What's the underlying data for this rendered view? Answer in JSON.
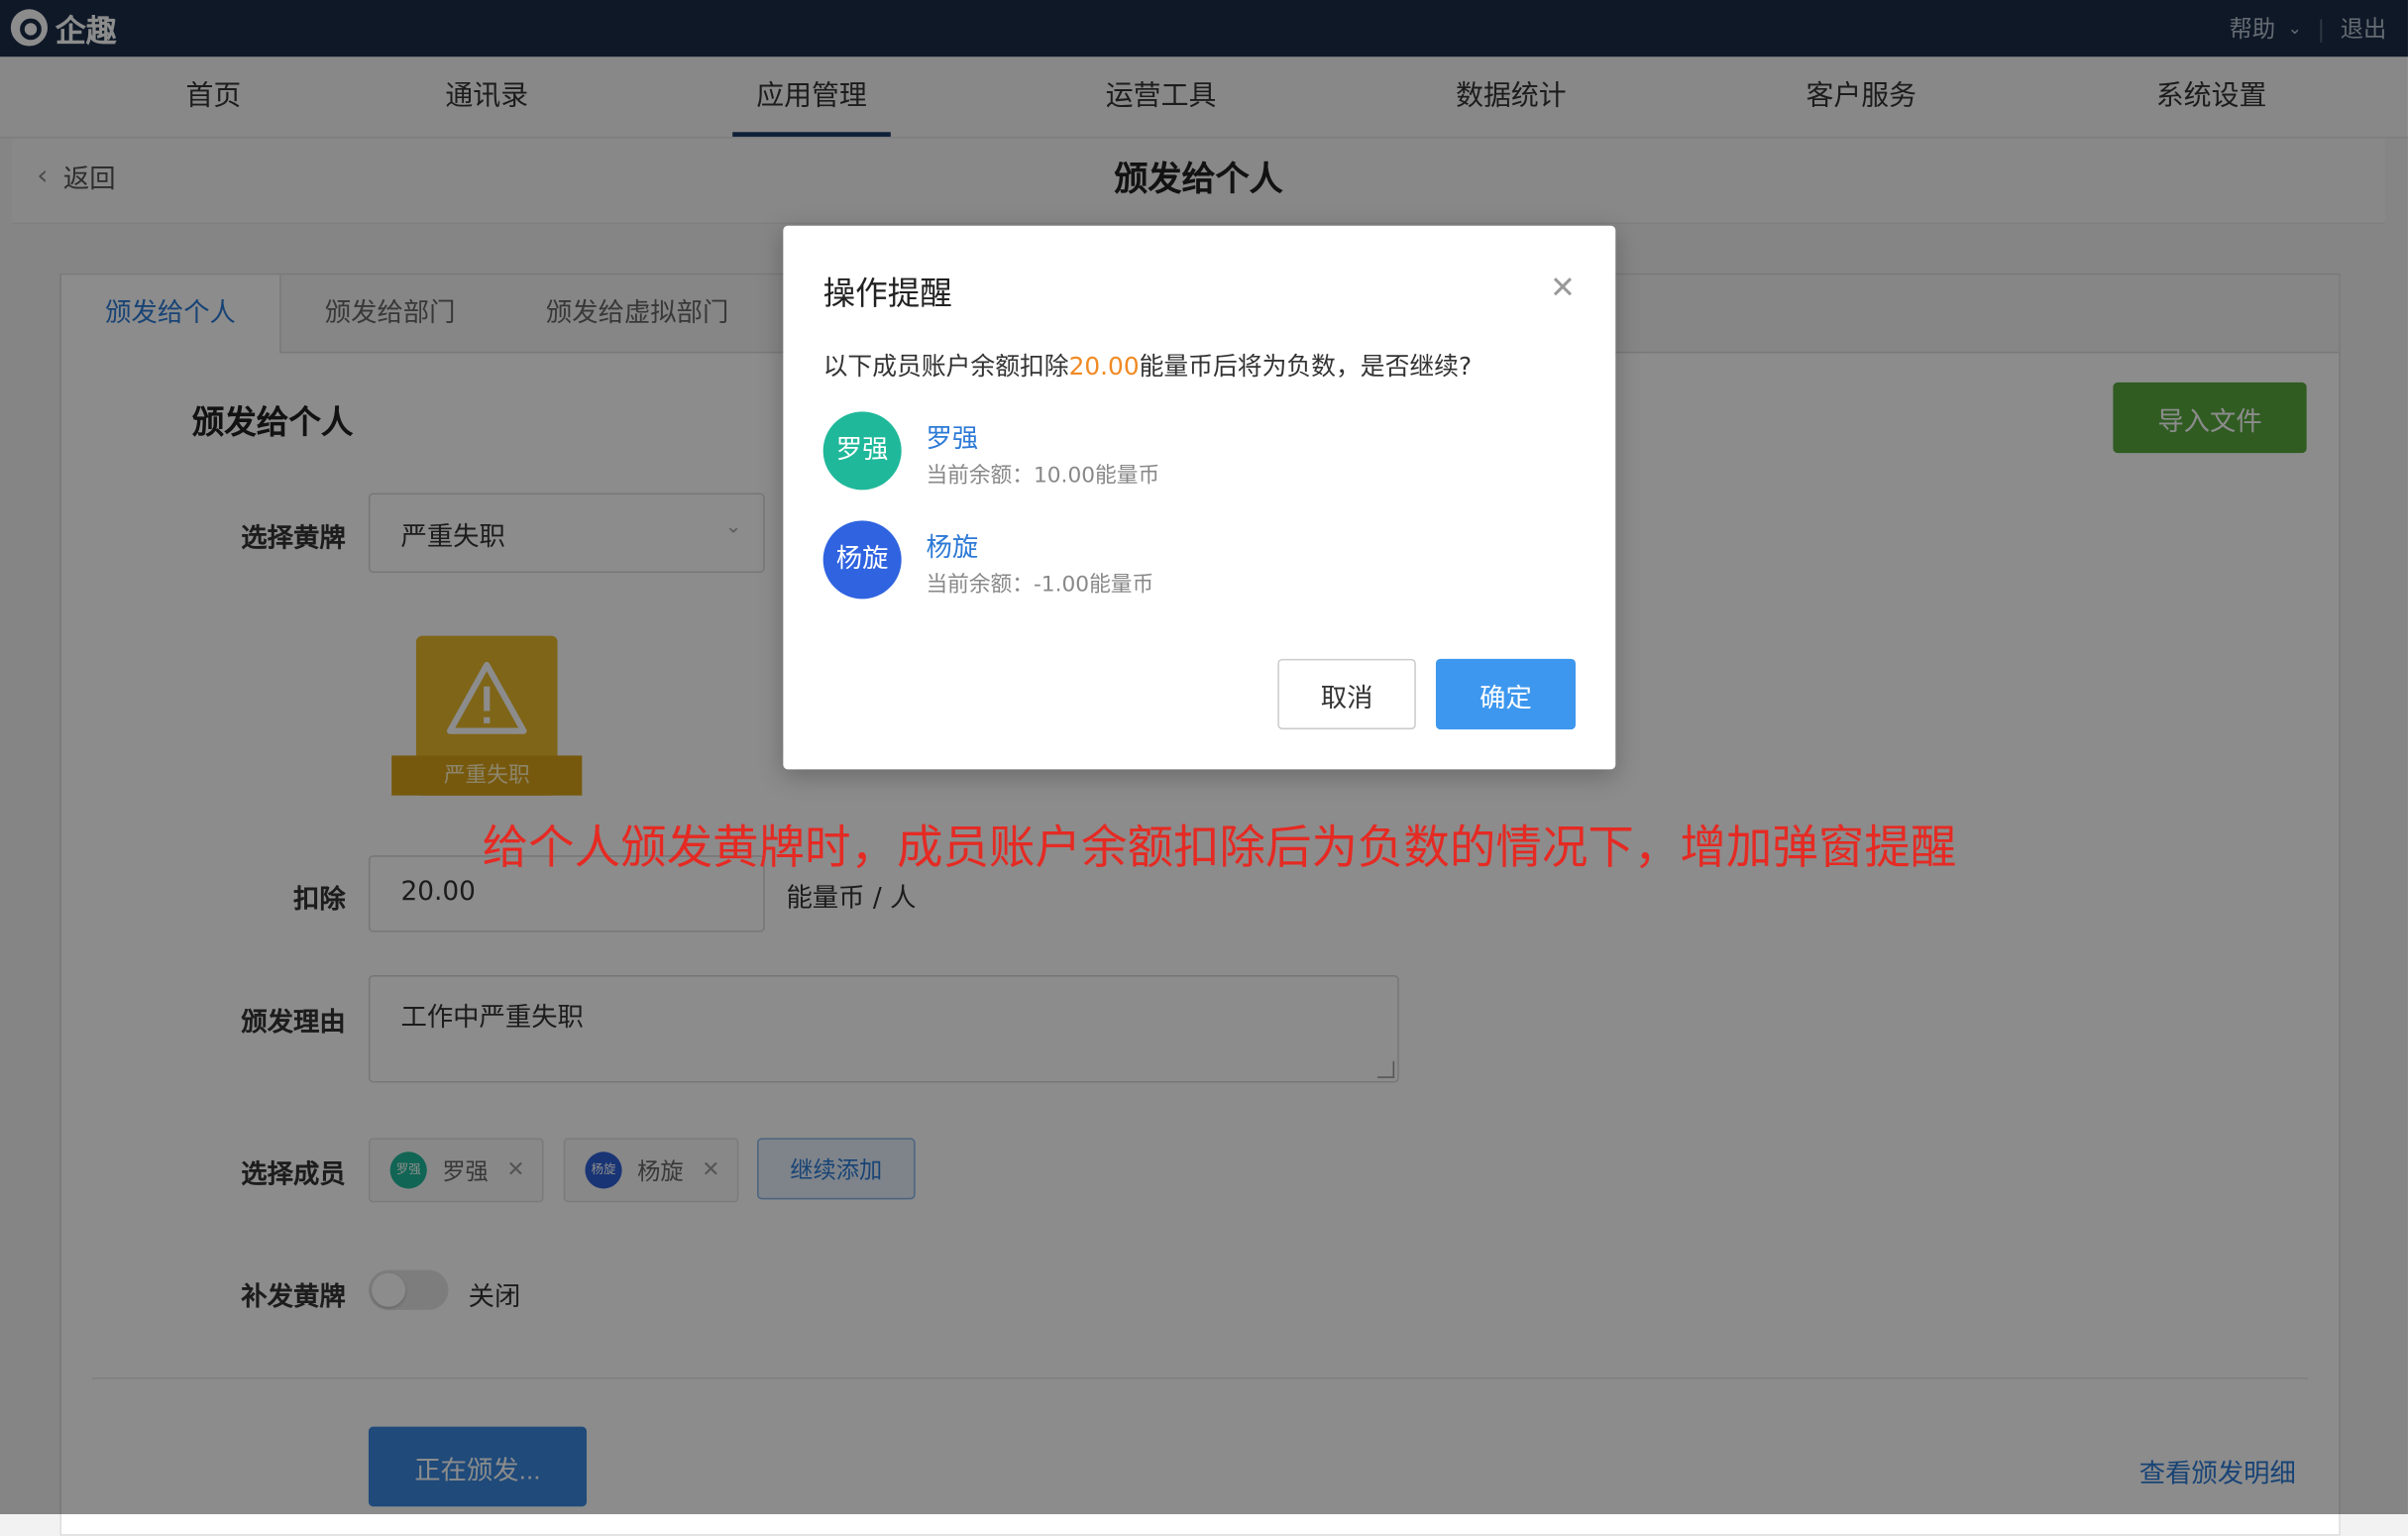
{
  "app": {
    "name": "企趣"
  },
  "topbar": {
    "help": "帮助",
    "logout": "退出"
  },
  "nav": {
    "items": [
      "首页",
      "通讯录",
      "应用管理",
      "运营工具",
      "数据统计",
      "客户服务",
      "系统设置"
    ],
    "active_index": 2
  },
  "subbar": {
    "back": "返回",
    "title": "颁发给个人"
  },
  "tabs": [
    "颁发给个人",
    "颁发给部门",
    "颁发给虚拟部门"
  ],
  "form": {
    "section_title": "颁发给个人",
    "import_button": "导入文件",
    "card_label": "选择黄牌",
    "card_value": "严重失职",
    "badge_text": "严重失职",
    "deduct_label": "扣除",
    "deduct_value": "20.00",
    "deduct_unit": "能量币 / 人",
    "reason_label": "颁发理由",
    "reason_value": "工作中严重失职",
    "members_label": "选择成员",
    "members": [
      {
        "avatar": "罗强",
        "name": "罗强",
        "color": "#1fb89a"
      },
      {
        "avatar": "杨旋",
        "name": "杨旋",
        "color": "#2c5fd6"
      }
    ],
    "add_more": "继续添加",
    "reissue_label": "补发黄牌",
    "reissue_state": "关闭",
    "submit": "正在颁发...",
    "detail_link": "查看颁发明细"
  },
  "annotation": "给个人颁发黄牌时，成员账户余额扣除后为负数的情况下，增加弹窗提醒",
  "modal": {
    "title": "操作提醒",
    "msg_prefix": "以下成员账户余额扣除",
    "msg_amount": "20.00",
    "msg_suffix": "能量币后将为负数，是否继续?",
    "members": [
      {
        "avatar": "罗强",
        "name": "罗强",
        "balance": "当前余额：10.00能量币",
        "color": "#1fb89a"
      },
      {
        "avatar": "杨旋",
        "name": "杨旋",
        "balance": "当前余额：-1.00能量币",
        "color": "#2f63e0"
      }
    ],
    "cancel": "取消",
    "confirm": "确定"
  },
  "colors": {
    "topbar": "#1a2d47",
    "primary": "#3d97ee",
    "import": "#58a83f",
    "badge": "#e8b82a",
    "annotation": "#e52a23",
    "amount": "#f08a24"
  }
}
